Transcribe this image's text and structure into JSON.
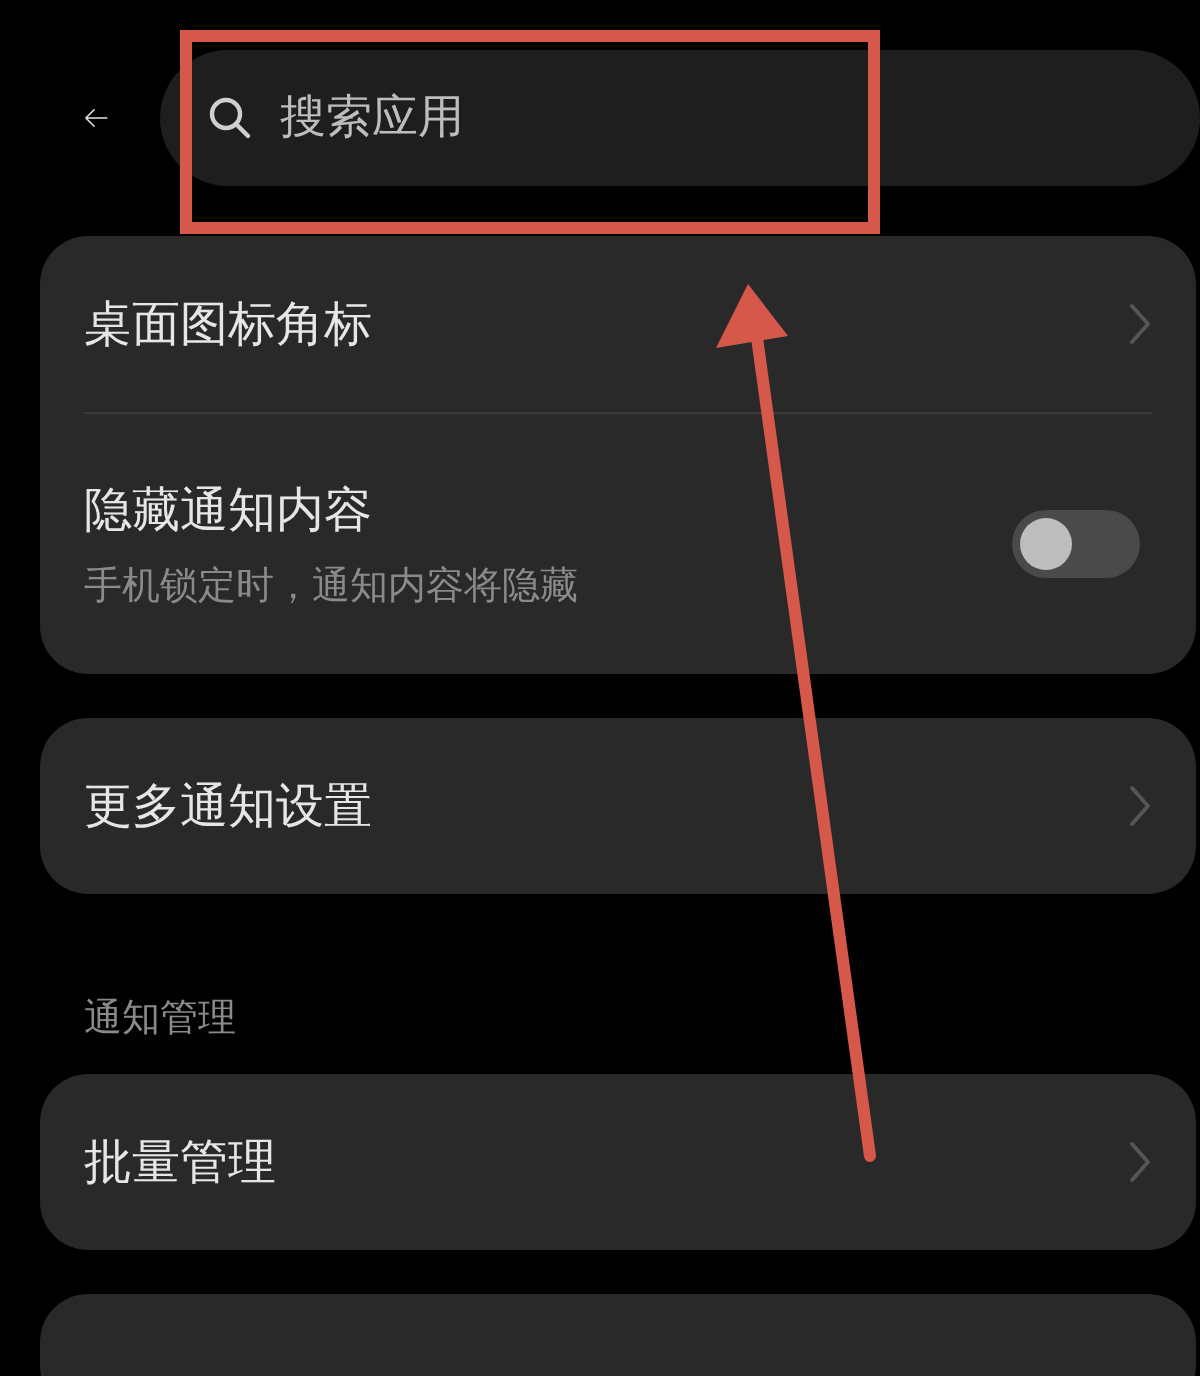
{
  "search": {
    "placeholder": "搜索应用"
  },
  "groups": [
    {
      "rows": [
        {
          "kind": "link",
          "title": "桌面图标角标"
        },
        {
          "kind": "toggle",
          "title": "隐藏通知内容",
          "subtitle": "手机锁定时，通知内容将隐藏",
          "on": false
        }
      ]
    },
    {
      "rows": [
        {
          "kind": "link",
          "title": "更多通知设置"
        }
      ]
    },
    {
      "header": "通知管理",
      "rows": [
        {
          "kind": "link",
          "title": "批量管理"
        }
      ]
    },
    {
      "rows": [
        {
          "kind": "empty"
        }
      ]
    }
  ]
}
